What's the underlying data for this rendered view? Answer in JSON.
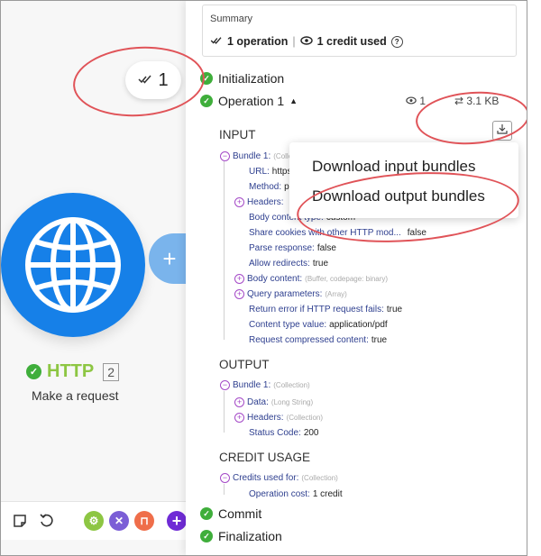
{
  "canvas": {
    "ops_bubble": {
      "count": "1"
    },
    "module": {
      "name": "HTTP",
      "number": "2",
      "subtitle": "Make a request",
      "add_symbol": "+"
    },
    "toolbar": {
      "icons": [
        "note-icon",
        "undo-icon",
        "settings-icon",
        "tools-icon",
        "flow-control-icon",
        "add-icon"
      ]
    }
  },
  "panel": {
    "summary": {
      "title": "Summary",
      "operations": "1 operation",
      "credits": "1 credit used"
    },
    "steps": {
      "initialization": "Initialization",
      "operation": "Operation 1",
      "operation_views": "1",
      "operation_size": "3.1 KB",
      "commit": "Commit",
      "finalization": "Finalization"
    },
    "input": {
      "heading": "INPUT",
      "bundle_label": "Bundle 1:",
      "bundle_type": "(Collection)",
      "url_key": "URL:",
      "url_val": "https:",
      "method_key": "Method:",
      "method_val": "p",
      "headers_key": "Headers:",
      "body_content_type_key": "Body content type:",
      "body_content_type_val": "custom",
      "share_cookies_key": "Share cookies with other HTTP mod...",
      "share_cookies_val": "false",
      "parse_response_key": "Parse response:",
      "parse_response_val": "false",
      "allow_redirects_key": "Allow redirects:",
      "allow_redirects_val": "true",
      "body_content_key": "Body content:",
      "body_content_type": "(Buffer, codepage: binary)",
      "query_params_key": "Query parameters:",
      "query_params_type": "(Array)",
      "return_error_key": "Return error if HTTP request fails:",
      "return_error_val": "true",
      "content_type_value_key": "Content type value:",
      "content_type_value_val": "application/pdf",
      "request_compressed_key": "Request compressed content:",
      "request_compressed_val": "true"
    },
    "output": {
      "heading": "OUTPUT",
      "bundle_label": "Bundle 1:",
      "bundle_type": "(Collection)",
      "data_key": "Data:",
      "data_type": "(Long String)",
      "headers_key": "Headers:",
      "headers_type": "(Collection)",
      "status_key": "Status Code:",
      "status_val": "200"
    },
    "credit_usage": {
      "heading": "CREDIT USAGE",
      "credits_for_key": "Credits used for:",
      "credits_for_type": "(Collection)",
      "operation_cost_key": "Operation cost:",
      "operation_cost_val": "1 credit"
    },
    "download_menu": {
      "input_label": "Download input bundles",
      "output_label": "Download output bundles"
    }
  },
  "colors": {
    "accent": "#1680e8",
    "success": "#3fae3b",
    "module_name": "#8dc643",
    "annotation": "#e05358",
    "tree_toggle": "#a449c7"
  }
}
